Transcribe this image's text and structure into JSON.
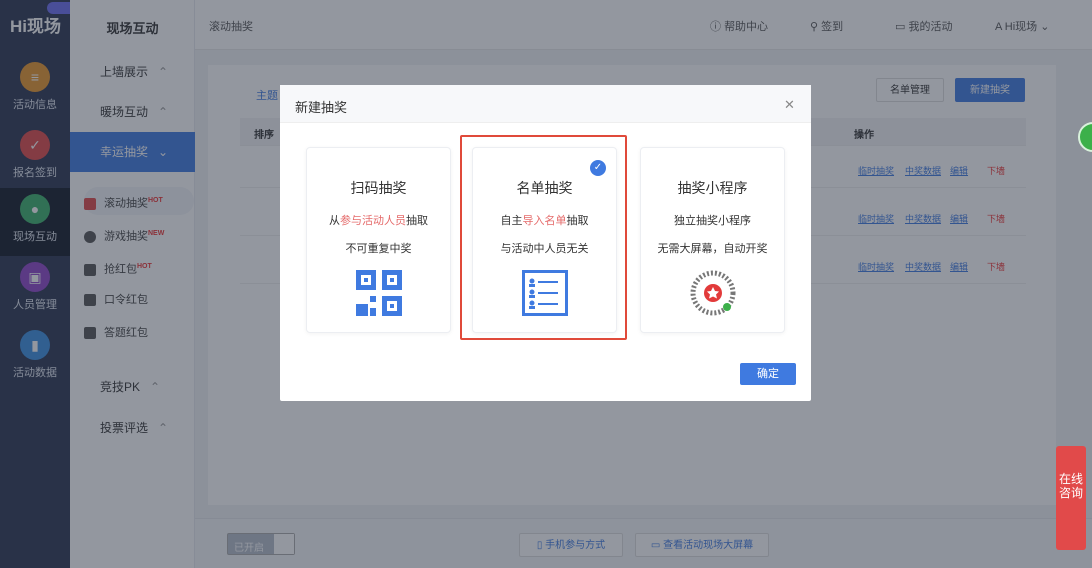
{
  "app": {
    "logo": "Hi现场"
  },
  "rail": [
    {
      "label": "活动信息",
      "color": "#e8962a",
      "icon": "doc"
    },
    {
      "label": "报名签到",
      "color": "#e04848",
      "icon": "calendar-check"
    },
    {
      "label": "现场互动",
      "color": "#3bb06a",
      "icon": "chat"
    },
    {
      "label": "人员管理",
      "color": "#8e44c8",
      "icon": "person"
    },
    {
      "label": "活动数据",
      "color": "#3a8ee0",
      "icon": "bar-chart"
    }
  ],
  "side": {
    "title": "现场互动",
    "groups": [
      "上墙展示",
      "暖场互动",
      "幸运抽奖",
      "竞技PK",
      "投票评选"
    ],
    "subs": [
      {
        "label": "滚动抽奖",
        "badge": "HOT"
      },
      {
        "label": "游戏抽奖",
        "badge": "NEW"
      },
      {
        "label": "抢红包",
        "badge": "HOT"
      },
      {
        "label": "口令红包",
        "badge": ""
      },
      {
        "label": "答题红包",
        "badge": ""
      }
    ]
  },
  "header": {
    "breadcrumb": "滚动抽奖",
    "help": "帮助中心",
    "signin": "签到",
    "my_events": "我的活动",
    "user": "Hi现场"
  },
  "content": {
    "tab": "主题",
    "list_btn": "名单管理",
    "new_btn": "新建抽奖",
    "col_sort": "排序",
    "col_ops": "操作",
    "rows": [
      {
        "a": "临时抽奖",
        "b": "中奖数据",
        "c": "编辑",
        "d": "下墙"
      },
      {
        "a": "临时抽奖",
        "b": "中奖数据",
        "c": "编辑",
        "d": "下墙"
      },
      {
        "a": "临时抽奖",
        "b": "中奖数据",
        "c": "编辑",
        "d": "下墙"
      }
    ]
  },
  "footer": {
    "toggle": "已开启",
    "mobile": "手机参与方式",
    "screen": "查看活动现场大屏幕"
  },
  "float": {
    "consult": "在线咨询"
  },
  "modal": {
    "title": "新建抽奖",
    "confirm": "确定",
    "cards": [
      {
        "title": "扫码抽奖",
        "d1a": "从",
        "d1b": "参与活动人员",
        "d1c": "抽取",
        "d2": "不可重复中奖"
      },
      {
        "title": "名单抽奖",
        "d1a": "自主",
        "d1b": "导入名单",
        "d1c": "抽取",
        "d2": "与活动中人员无关"
      },
      {
        "title": "抽奖小程序",
        "d1a": "独立抽奖小程序",
        "d1b": "",
        "d1c": "",
        "d2": "无需大屏幕，自动开奖"
      }
    ]
  }
}
